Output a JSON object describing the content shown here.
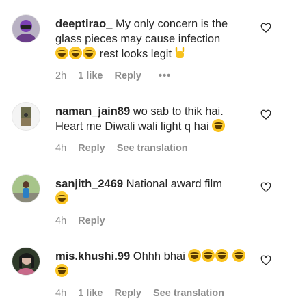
{
  "comments": [
    {
      "username": "deeptirao_",
      "text": "My only concern is the glass pieces may cause infection",
      "text_after": "rest looks legit",
      "time": "2h",
      "likes": "1 like",
      "reply": "Reply",
      "more": "•••"
    },
    {
      "username": "naman_jain89",
      "text": "wo sab to thik hai. Heart me Diwali wali light q hai",
      "time": "4h",
      "reply": "Reply",
      "see_translation": "See translation"
    },
    {
      "username": "sanjith_2469",
      "text": "National award film",
      "time": "4h",
      "reply": "Reply"
    },
    {
      "username": "mis.khushi.99",
      "text": "Ohhh bhai",
      "time": "4h",
      "likes": "1 like",
      "reply": "Reply",
      "see_translation": "See translation"
    }
  ],
  "icons": {
    "like": "heart-outline-icon",
    "emoji": "face-with-tears-of-joy-icon",
    "gesture": "sign-of-horns-icon"
  },
  "colors": {
    "text": "#262626",
    "secondary": "#8e8e8e",
    "background": "#ffffff"
  }
}
